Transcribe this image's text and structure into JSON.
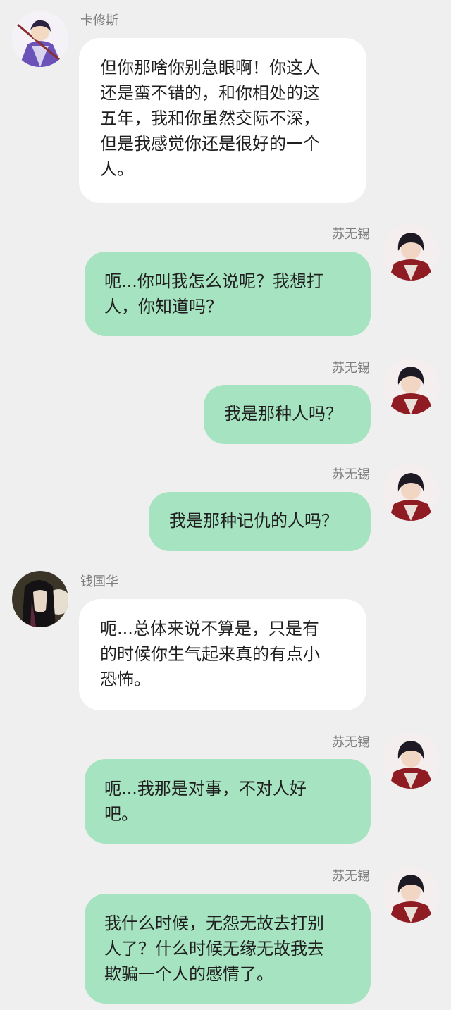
{
  "conversation": {
    "messages": [
      {
        "sender": "卡修斯",
        "direction": "incoming",
        "avatar_icon": "purple-samurai-avatar",
        "text": "但你那啥你别急眼啊！你这人\n还是蛮不错的，和你相处的这\n五年，我和你虽然交际不深，\n但是我感觉你还是很好的一个\n人。"
      },
      {
        "sender": "苏无锡",
        "direction": "outgoing",
        "avatar_icon": "dark-hair-red-armor-avatar",
        "text": "呃...你叫我怎么说呢？我想打\n人，你知道吗？"
      },
      {
        "sender": "苏无锡",
        "direction": "outgoing",
        "avatar_icon": "dark-hair-red-armor-avatar",
        "text": "我是那种人吗？"
      },
      {
        "sender": "苏无锡",
        "direction": "outgoing",
        "avatar_icon": "dark-hair-red-armor-avatar",
        "text": "我是那种记仇的人吗？"
      },
      {
        "sender": "钱国华",
        "direction": "incoming",
        "avatar_icon": "long-black-hair-avatar",
        "text": "呃...总体来说不算是，只是有\n的时候你生气起来真的有点小\n恐怖。"
      },
      {
        "sender": "苏无锡",
        "direction": "outgoing",
        "avatar_icon": "dark-hair-red-armor-avatar",
        "text": "呃...我那是对事，不对人好\n吧。"
      },
      {
        "sender": "苏无锡",
        "direction": "outgoing",
        "avatar_icon": "dark-hair-red-armor-avatar",
        "text": "我什么时候，无怨无故去打别\n人了？什么时候无缘无故我去\n欺骗一个人的感情了。"
      }
    ]
  },
  "colors": {
    "background": "#efefef",
    "incoming_bubble": "#ffffff",
    "outgoing_bubble": "#a6e3c0",
    "name_text": "#7d7d7d",
    "message_text": "#1f1f1f"
  }
}
